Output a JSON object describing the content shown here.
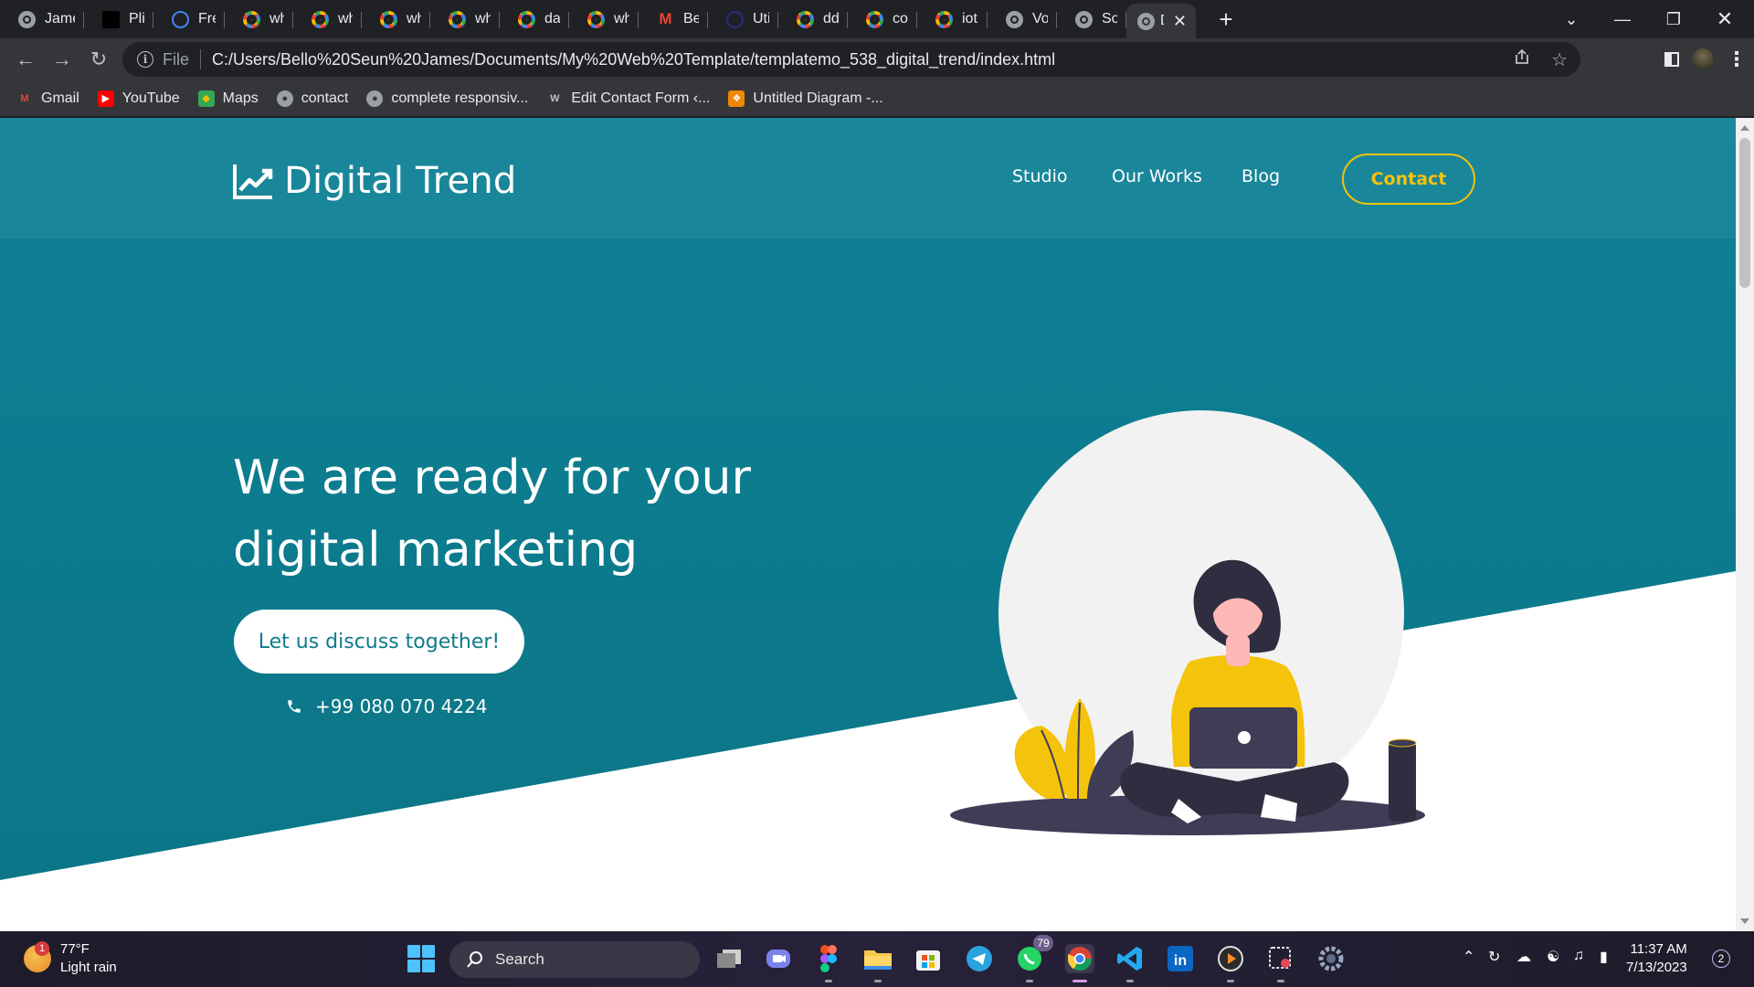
{
  "browser": {
    "tabs": [
      {
        "label": "Jamez",
        "icon": "chrome-icon",
        "color": "#9aa0a6"
      },
      {
        "label": "Plian E",
        "icon": "plian-icon",
        "color": "#000000"
      },
      {
        "label": "Free P",
        "icon": "free-icon",
        "color": "#4285f4"
      },
      {
        "label": "what i",
        "icon": "google-icon",
        "color": "#ffffff"
      },
      {
        "label": "what i",
        "icon": "google-icon",
        "color": "#ffffff"
      },
      {
        "label": "what i",
        "icon": "google-icon",
        "color": "#ffffff"
      },
      {
        "label": "what i",
        "icon": "google-icon",
        "color": "#ffffff"
      },
      {
        "label": "data b",
        "icon": "google-icon",
        "color": "#ffffff"
      },
      {
        "label": "what i",
        "icon": "google-icon",
        "color": "#ffffff"
      },
      {
        "label": "Bello,",
        "icon": "gmail-icon",
        "color": "#ea4335"
      },
      {
        "label": "Utiva |",
        "icon": "utiva-icon",
        "color": "#2a2a80"
      },
      {
        "label": "ddos v",
        "icon": "google-icon",
        "color": "#ffffff"
      },
      {
        "label": "coseq",
        "icon": "google-icon",
        "color": "#ffffff"
      },
      {
        "label": "iot - G",
        "icon": "google-icon",
        "color": "#ffffff"
      },
      {
        "label": "Volton",
        "icon": "chrome-icon",
        "color": "#9aa0a6"
      },
      {
        "label": "Softy I",
        "icon": "chrome-icon",
        "color": "#9aa0a6"
      }
    ],
    "active_tab": {
      "label": "Dig",
      "icon": "chrome-icon"
    },
    "new_tab_label": "+",
    "url_scheme_label": "File",
    "url": "C:/Users/Bello%20Seun%20James/Documents/My%20Web%20Template/templatemo_538_digital_trend/index.html",
    "bookmarks": [
      {
        "label": "Gmail",
        "icon": "gmail-icon"
      },
      {
        "label": "YouTube",
        "icon": "youtube-icon"
      },
      {
        "label": "Maps",
        "icon": "maps-icon"
      },
      {
        "label": "contact",
        "icon": "globe-icon"
      },
      {
        "label": "complete responsiv...",
        "icon": "globe-icon"
      },
      {
        "label": "Edit Contact Form ‹...",
        "icon": "wordpress-icon"
      },
      {
        "label": "Untitled Diagram -...",
        "icon": "drawio-icon"
      }
    ]
  },
  "site": {
    "brand": "Digital Trend",
    "nav": [
      "Studio",
      "Our Works",
      "Blog"
    ],
    "contact_button": "Contact",
    "hero_line1": "We are ready for your",
    "hero_line2": "digital marketing",
    "cta_button": "Let us discuss together!",
    "phone": "+99 080 070 4224",
    "colors": {
      "primary": "#0d7b8c",
      "accent": "#f4c30b",
      "illustration_dark": "#3f3d56"
    }
  },
  "taskbar": {
    "weather_temp": "77°F",
    "weather_desc": "Light rain",
    "weather_badge": "1",
    "search_label": "Search",
    "whatsapp_badge": "79",
    "time": "11:37 AM",
    "date": "7/13/2023",
    "notification_count": "2"
  }
}
